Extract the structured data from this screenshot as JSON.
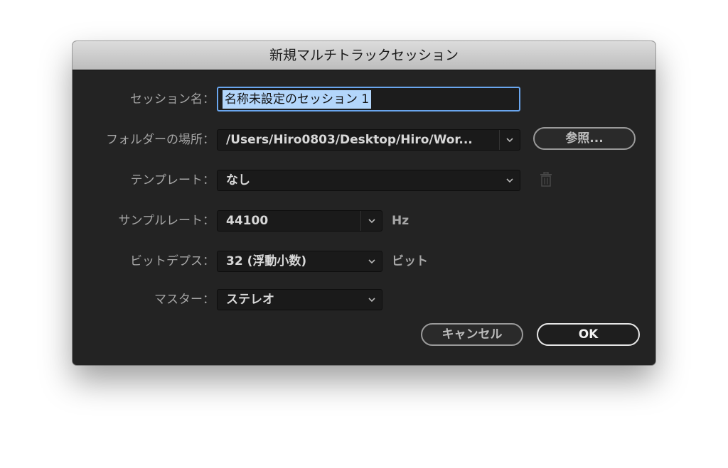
{
  "dialog": {
    "title": "新規マルチトラックセッション"
  },
  "session_name": {
    "label": "セッション名：",
    "value": "名称未設定のセッション 1"
  },
  "folder": {
    "label": "フォルダーの場所：",
    "value": "/Users/Hiro0803/Desktop/Hiro/Wor...",
    "browse_label": "参照..."
  },
  "template": {
    "label": "テンプレート：",
    "value": "なし",
    "delete_icon": "trash-icon"
  },
  "sample_rate": {
    "label": "サンプルレート：",
    "value": "44100",
    "unit": "Hz"
  },
  "bit_depth": {
    "label": "ビットデプス：",
    "value": "32 (浮動小数)",
    "unit": "ビット"
  },
  "master": {
    "label": "マスター：",
    "value": "ステレオ"
  },
  "buttons": {
    "cancel_label": "キャンセル",
    "ok_label": "OK"
  },
  "colors": {
    "dialog_bg": "#232323",
    "titlebar": "#c8c8c8",
    "selection": "#b3d6fb",
    "focus_ring": "#6aa6ee"
  }
}
